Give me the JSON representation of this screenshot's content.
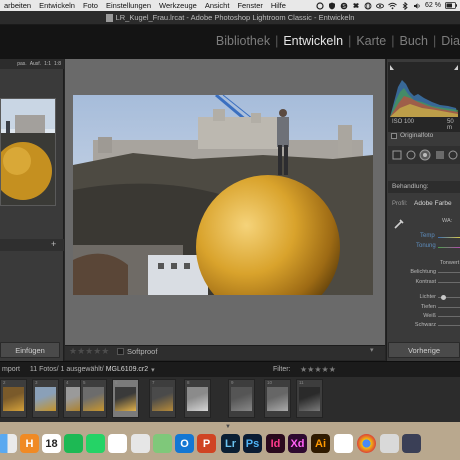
{
  "menubar": {
    "items": [
      "arbeiten",
      "Entwickeln",
      "Foto",
      "Einstellungen",
      "Werkzeuge",
      "Ansicht",
      "Fenster",
      "Hilfe"
    ],
    "battery": "62 %"
  },
  "window": {
    "title": "LR_Kugel_Frau.lrcat - Adobe Photoshop Lightroom Classic - Entwickeln"
  },
  "modules": [
    "Bibliothek",
    "Entwickeln",
    "Karte",
    "Buch",
    "Dia"
  ],
  "active_module": "Entwickeln",
  "navigator": {
    "label": "pas.",
    "fit": "Ausf.",
    "ratio1": "1:1",
    "ratio2": "1:8"
  },
  "left_panel": {
    "paste_button": "Einfügen"
  },
  "toolbar": {
    "softproof_label": "Softproof",
    "stars": "★★★★★"
  },
  "histogram": {
    "iso": "ISO 100",
    "focal": "50 m",
    "original_photo_label": "Originalfoto"
  },
  "develop": {
    "section_label": "Behandlung:",
    "profile_label": "Profil:",
    "profile_value": "Adobe Farbe",
    "wb_label": "WA:",
    "temp_label": "Temp",
    "tint_label": "Tonung",
    "tone_label": "Tonwert",
    "sliders": [
      "Belichtung",
      "Kontrast",
      "Lichter",
      "Tiefen",
      "Weiß",
      "Schwarz"
    ]
  },
  "right_panel": {
    "previous_button": "Vorherige"
  },
  "filmstrip": {
    "source_prefix": "mport",
    "count_text": "11 Fotos/ 1 ausgewählt/",
    "filename": "MGL6109.cr2",
    "filter_label": "Filter:",
    "filter_stars": "★★★★★",
    "cells": [
      {
        "num": "2"
      },
      {
        "num": "3"
      },
      {
        "num": "4"
      },
      {
        "num": "5"
      },
      {
        "num": "6"
      },
      {
        "num": "7"
      },
      {
        "num": "8"
      },
      {
        "num": "9"
      },
      {
        "num": "10"
      },
      {
        "num": "11"
      }
    ]
  },
  "dock": {
    "apps": [
      "finder-icon",
      "hype-icon",
      "calendar-icon",
      "spotify-icon",
      "whatsapp-icon",
      "slack-icon",
      "cog-icon",
      "maps-icon",
      "outlook-icon",
      "powerpoint-icon",
      "lightroom-icon",
      "photoshop-icon",
      "indesign-icon",
      "xd-icon",
      "illustrator-icon",
      "acrobat-icon",
      "chrome-icon",
      "preview-icon",
      "launchpad-icon"
    ],
    "labels": {
      "lightroom": "Lr",
      "photoshop": "Ps",
      "indesign": "Id",
      "xd": "Xd",
      "illustrator": "Ai",
      "hype": "H",
      "calendar": "18",
      "outlook": "O",
      "powerpoint": "P"
    }
  }
}
